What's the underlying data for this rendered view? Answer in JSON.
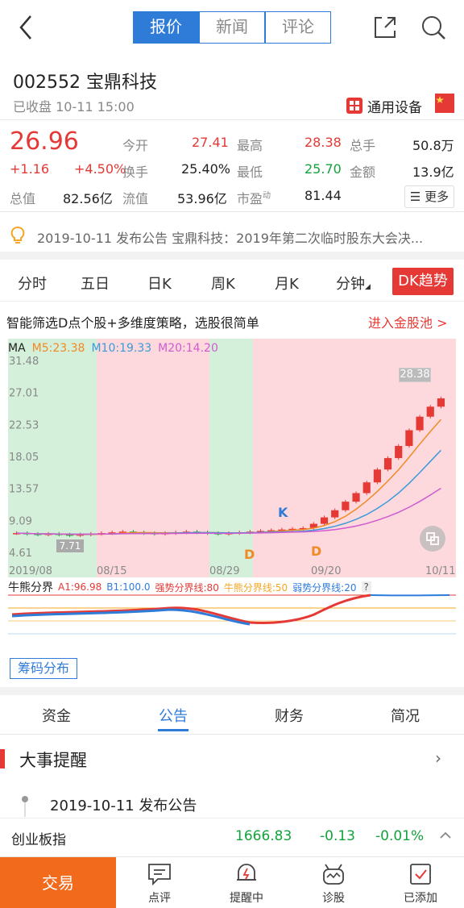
{
  "header": {
    "back_icon": "chevron-left-icon",
    "tabs": [
      "报价",
      "新闻",
      "评论"
    ],
    "active_tab": 0,
    "share_icon": "share-icon",
    "search_icon": "search-icon"
  },
  "stock": {
    "code_name": "002552 宝鼎科技",
    "status": "已收盘 10-11 15:00",
    "industry": "通用设备"
  },
  "quote": {
    "price": "26.96",
    "change": "+1.16",
    "change_pct": "+4.50%",
    "rows": [
      [
        {
          "label": "今开",
          "value": "27.41"
        },
        {
          "label": "最高",
          "value": "28.38"
        },
        {
          "label": "总手",
          "value": "50.8万"
        }
      ],
      [
        {
          "label": "换手",
          "value": "25.40%"
        },
        {
          "label": "最低",
          "value": "25.70"
        },
        {
          "label": "金额",
          "value": "13.9亿"
        }
      ]
    ],
    "total_value_label": "总值",
    "total_value": "82.56亿",
    "float_label": "流值",
    "float_value": "53.96亿",
    "pe_label": "市盈",
    "pe_sup": "动",
    "pe_value": "81.44",
    "more": "☰ 更多"
  },
  "notice": {
    "text": "2019-10-11 发布公告 宝鼎科技：2019年第二次临时股东大会决..."
  },
  "chart_tabs": [
    "分时",
    "五日",
    "日K",
    "周K",
    "月K",
    "分钟",
    "DK趋势"
  ],
  "promo": {
    "text": "智能筛选D点个股+多维度策略，选股很简单",
    "link": "进入金股池 >"
  },
  "ma_legend": {
    "ma": "MA",
    "m5": "M5:23.38",
    "m10": "M10:19.33",
    "m20": "M20:14.20"
  },
  "colors": {
    "red": "#e53935",
    "green": "#13a33b",
    "blue": "#2f7bd8",
    "orange": "#f08a24",
    "m5": "#f08a24",
    "m10": "#3a9bd8",
    "m20": "#d05bd0"
  },
  "chart_data": {
    "type": "candlestick",
    "y_ticks": [
      "31.48",
      "27.01",
      "22.53",
      "18.05",
      "13.57",
      "9.09",
      "4.61"
    ],
    "x_ticks": [
      "2019/08",
      "08/15",
      "08/29",
      "09/20",
      "10/11"
    ],
    "max_label": "28.38",
    "min_label": "7.71",
    "markers": [
      "K",
      "D",
      "D"
    ],
    "closes": [
      8.1,
      8.0,
      7.9,
      8.0,
      7.9,
      7.8,
      7.9,
      8.0,
      8.1,
      8.2,
      8.3,
      8.2,
      8.1,
      8.0,
      8.1,
      8.2,
      8.3,
      8.2,
      8.1,
      8.0,
      8.1,
      8.2,
      8.3,
      8.4,
      8.5,
      8.6,
      8.7,
      8.8,
      9.4,
      10.3,
      11.3,
      12.5,
      13.7,
      15.2,
      17.0,
      18.6,
      20.3,
      22.5,
      24.4,
      25.8,
      26.96
    ]
  },
  "indicator": {
    "title": "牛熊分界",
    "a1": "A1:96.98",
    "b1": "B1:100.0",
    "strong": "强势分界线:80",
    "mid": "牛熊分界线:50",
    "weak": "弱势分界线:20",
    "help": "?"
  },
  "chip_button": "筹码分布",
  "section_tabs": [
    "资金",
    "公告",
    "财务",
    "简况"
  ],
  "active_section": 1,
  "events": {
    "title": "大事提醒",
    "item": "2019-10-11 发布公告"
  },
  "index_bar": {
    "name": "创业板指",
    "value": "1666.83",
    "change": "-0.13",
    "pct": "-0.01%"
  },
  "bottom_nav": {
    "trade": "交易",
    "items": [
      "点评",
      "提醒中",
      "诊股",
      "已添加"
    ]
  }
}
